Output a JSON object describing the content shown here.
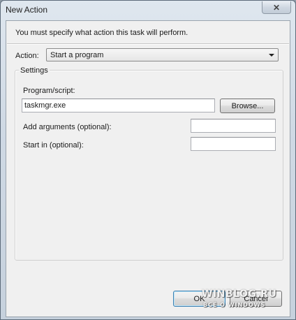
{
  "window": {
    "title": "New Action",
    "close_glyph": "✕"
  },
  "dialog": {
    "instruction": "You must specify what action this task will perform.",
    "action_label": "Action:",
    "action_value": "Start a program",
    "settings_title": "Settings",
    "program_label": "Program/script:",
    "program_value": "taskmgr.exe",
    "browse_label": "Browse...",
    "arguments_label": "Add arguments (optional):",
    "arguments_value": "",
    "startin_label": "Start in (optional):",
    "startin_value": "",
    "ok_label": "OK",
    "cancel_label": "Cancel"
  },
  "watermark": {
    "line1": "WINBLOG.RU",
    "line2": "ВСЁ О WINDOWS"
  }
}
